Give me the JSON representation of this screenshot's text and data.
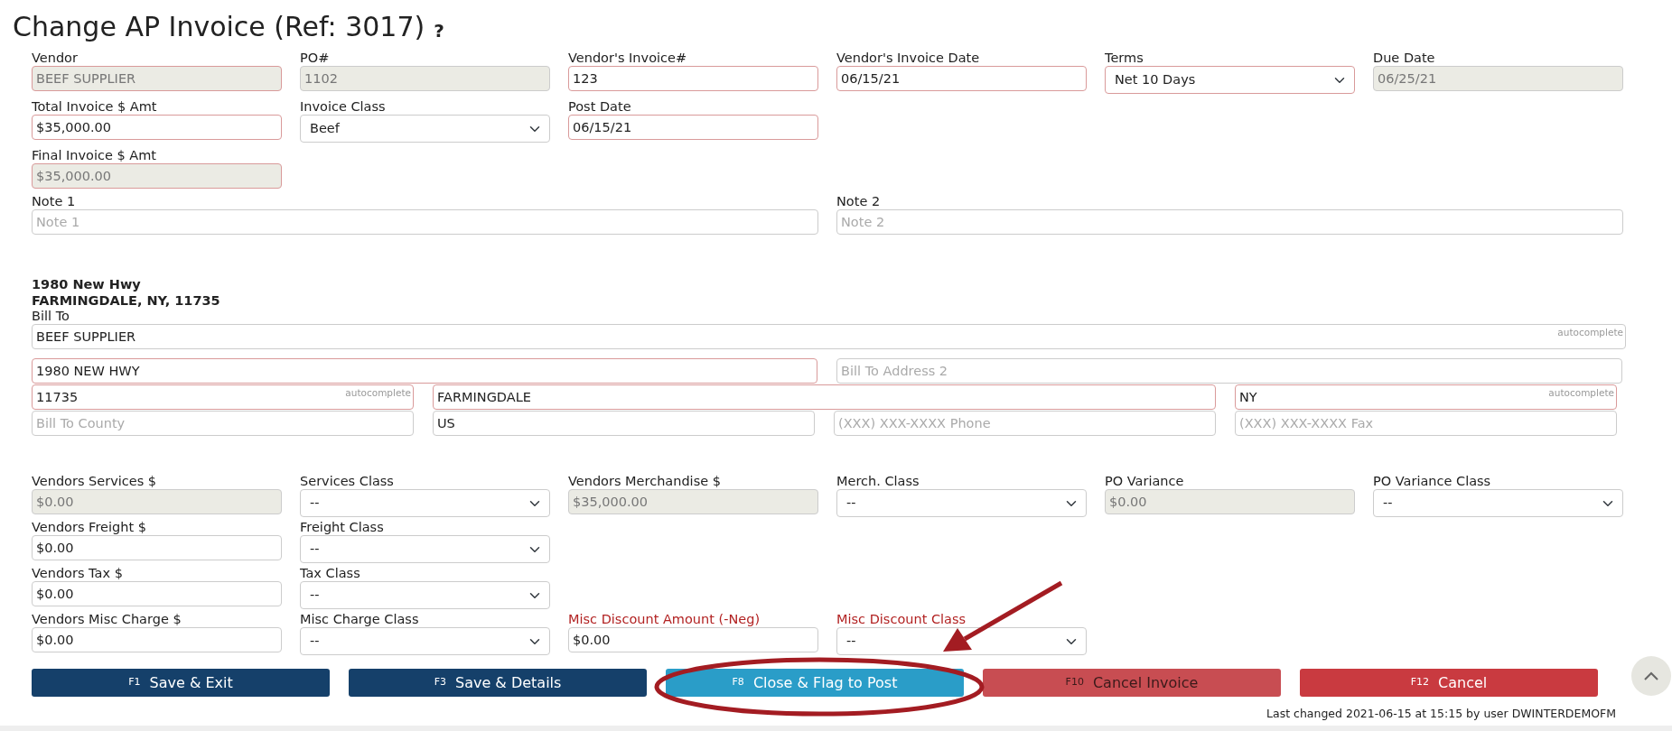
{
  "title": "Change AP Invoice (Ref: 3017)",
  "help": "?",
  "invoice_rows": [
    [
      {
        "label": "Vendor",
        "kind": "input",
        "value": "BEEF SUPPLIER",
        "disabled": true,
        "required": true
      },
      {
        "label": "PO#",
        "kind": "input",
        "value": "1102",
        "disabled": true,
        "required": false
      },
      {
        "label": "Vendor's Invoice#",
        "kind": "input",
        "value": "123",
        "disabled": false,
        "required": true
      },
      {
        "label": "Vendor's Invoice Date",
        "kind": "input",
        "value": "06/15/21",
        "disabled": false,
        "required": true
      },
      {
        "label": "Terms",
        "kind": "select",
        "value": "Net 10 Days",
        "disabled": false,
        "required": true
      },
      {
        "label": "Due Date",
        "kind": "input",
        "value": "06/25/21",
        "disabled": true,
        "required": false
      }
    ],
    [
      {
        "label": "Total Invoice $ Amt",
        "kind": "input",
        "value": "$35,000.00",
        "disabled": false,
        "required": true
      },
      {
        "label": "Invoice Class",
        "kind": "select",
        "value": "Beef",
        "disabled": false,
        "required": false
      },
      {
        "label": "Post Date",
        "kind": "input",
        "value": "06/15/21",
        "disabled": false,
        "required": true
      }
    ],
    [
      {
        "label": "Final Invoice $ Amt",
        "kind": "input",
        "value": "$35,000.00",
        "disabled": true,
        "required": true
      }
    ]
  ],
  "notes": [
    {
      "label": "Note 1",
      "placeholder": "Note 1"
    },
    {
      "label": "Note 2",
      "placeholder": "Note 2"
    }
  ],
  "address_lines": [
    "1980 New Hwy",
    "FARMINGDALE, NY, 11735"
  ],
  "bill_to": {
    "label": "Bill To",
    "name": {
      "value": "BEEF SUPPLIER",
      "hint": "autocomplete",
      "required": false
    },
    "street": [
      {
        "value": "1980 NEW HWY",
        "required": true
      },
      {
        "placeholder": "Bill To Address 2",
        "required": false
      }
    ],
    "locality": [
      {
        "value": "11735",
        "hint": "autocomplete",
        "required": true
      },
      {
        "value": "FARMINGDALE",
        "required": true
      },
      {
        "value": "NY",
        "hint": "autocomplete",
        "required": true
      }
    ],
    "contact": [
      {
        "placeholder": "Bill To County",
        "required": false
      },
      {
        "value": "US",
        "required": false
      },
      {
        "placeholder": "(XXX) XXX-XXXX Phone",
        "required": false
      },
      {
        "placeholder": "(XXX) XXX-XXXX Fax",
        "required": false
      }
    ]
  },
  "amount_rows": [
    [
      {
        "label": "Vendors Services $",
        "kind": "input",
        "value": "$0.00",
        "disabled": true,
        "emphasized": false
      },
      {
        "label": "Services Class",
        "kind": "select",
        "value": "--",
        "disabled": false,
        "emphasized": false
      },
      {
        "label": "Vendors Merchandise $",
        "kind": "input",
        "value": "$35,000.00",
        "disabled": true,
        "emphasized": false
      },
      {
        "label": "Merch. Class",
        "kind": "select",
        "value": "--",
        "disabled": false,
        "emphasized": false
      },
      {
        "label": "PO Variance",
        "kind": "input",
        "value": "$0.00",
        "disabled": true,
        "emphasized": false
      },
      {
        "label": "PO Variance Class",
        "kind": "select",
        "value": "--",
        "disabled": false,
        "emphasized": false
      }
    ],
    [
      {
        "label": "Vendors Freight $",
        "kind": "input",
        "value": "$0.00",
        "disabled": false,
        "emphasized": false
      },
      {
        "label": "Freight Class",
        "kind": "select",
        "value": "--",
        "disabled": false,
        "emphasized": false
      }
    ],
    [
      {
        "label": "Vendors Tax $",
        "kind": "input",
        "value": "$0.00",
        "disabled": false,
        "emphasized": false
      },
      {
        "label": "Tax Class",
        "kind": "select",
        "value": "--",
        "disabled": false,
        "emphasized": false
      }
    ],
    [
      {
        "label": "Vendors Misc Charge $",
        "kind": "input",
        "value": "$0.00",
        "disabled": false,
        "emphasized": false
      },
      {
        "label": "Misc Charge Class",
        "kind": "select",
        "value": "--",
        "disabled": false,
        "emphasized": false
      },
      {
        "label": "Misc Discount Amount (-Neg)",
        "kind": "input",
        "value": "$0.00",
        "disabled": false,
        "emphasized": true
      },
      {
        "label": "Misc Discount Class",
        "kind": "select",
        "value": "--",
        "disabled": false,
        "emphasized": true
      }
    ]
  ],
  "buttons": [
    {
      "key": "F1",
      "label": "Save & Exit",
      "kind": "primary",
      "disabled": false
    },
    {
      "key": "F3",
      "label": "Save & Details",
      "kind": "primary",
      "disabled": false
    },
    {
      "key": "F8",
      "label": "Close & Flag to Post",
      "kind": "info",
      "disabled": false
    },
    {
      "key": "F10",
      "label": "Cancel Invoice",
      "kind": "danger",
      "disabled": true
    },
    {
      "key": "F12",
      "label": "Cancel",
      "kind": "danger",
      "disabled": false
    }
  ],
  "footer": "Last changed 2021-06-15 at 15:15 by user DWINTERDEMOFM"
}
